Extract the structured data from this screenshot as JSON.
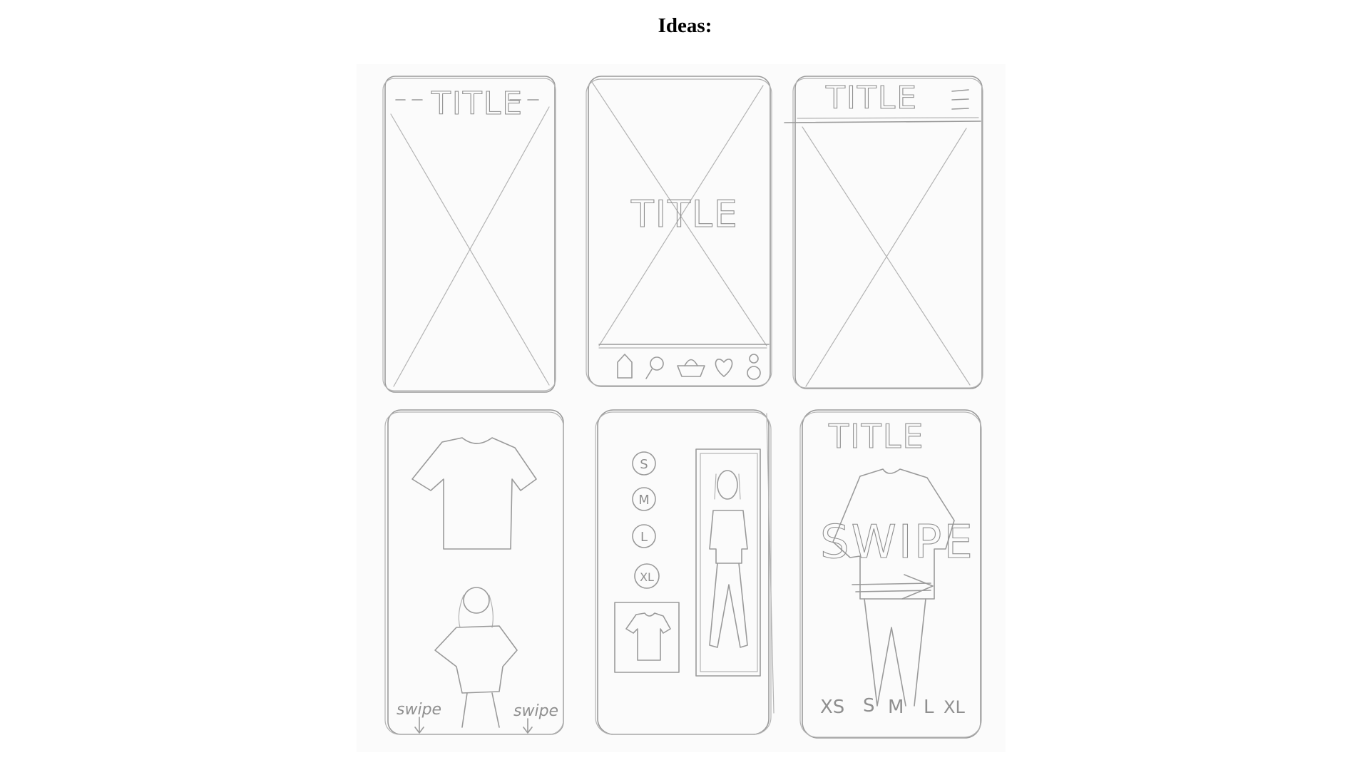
{
  "heading": "Ideas:",
  "sketches": {
    "phone1": {
      "title": "TITLE"
    },
    "phone2": {
      "title": "TITLE"
    },
    "phone3": {
      "title": "TITLE"
    },
    "phone4": {
      "swipe_left": "swipe",
      "swipe_right": "swipe"
    },
    "phone5": {
      "sizes": [
        "S",
        "M",
        "L",
        "XL"
      ]
    },
    "phone6": {
      "title": "TITLE",
      "overlay": "SWIPE",
      "sizes": [
        "XS",
        "S",
        "M",
        "L",
        "XL"
      ]
    }
  }
}
